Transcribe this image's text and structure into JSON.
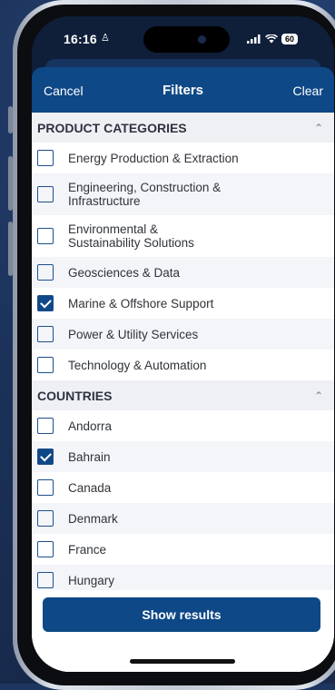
{
  "status": {
    "time": "16:16",
    "battery": "60"
  },
  "nav": {
    "cancel": "Cancel",
    "title": "Filters",
    "clear": "Clear"
  },
  "product_categories": {
    "header": "PRODUCT CATEGORIES",
    "items": [
      {
        "label": "Energy Production & Extraction",
        "checked": false
      },
      {
        "label": "Engineering, Construction & Infrastructure",
        "checked": false
      },
      {
        "label": "Environmental & Sustainability Solutions",
        "checked": false
      },
      {
        "label": "Geosciences & Data",
        "checked": false
      },
      {
        "label": "Marine & Offshore Support",
        "checked": true
      },
      {
        "label": "Power & Utility Services",
        "checked": false
      },
      {
        "label": "Technology & Automation",
        "checked": false
      }
    ]
  },
  "countries": {
    "header": "COUNTRIES",
    "items": [
      {
        "label": "Andorra",
        "checked": false
      },
      {
        "label": "Bahrain",
        "checked": true
      },
      {
        "label": "Canada",
        "checked": false
      },
      {
        "label": "Denmark",
        "checked": false
      },
      {
        "label": "France",
        "checked": false
      },
      {
        "label": "Hungary",
        "checked": false
      }
    ]
  },
  "footer": {
    "show_results": "Show results"
  }
}
